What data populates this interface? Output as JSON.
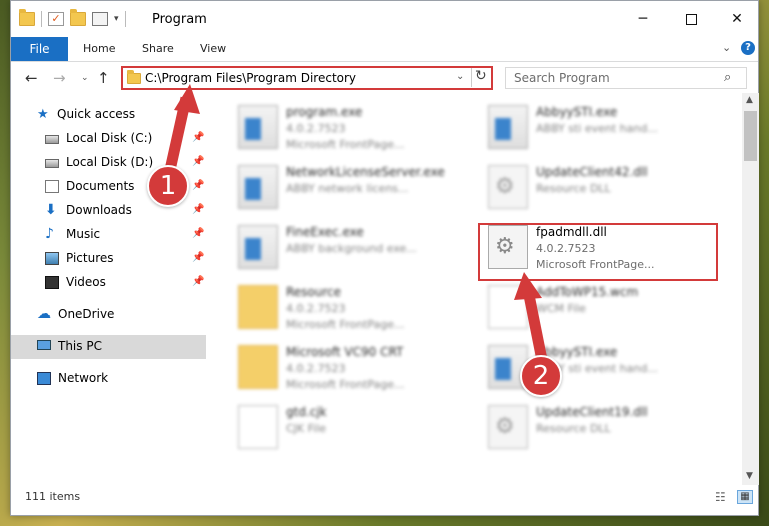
{
  "window": {
    "title": "Program",
    "controls": {
      "minimize": "─",
      "close": "✕"
    }
  },
  "ribbon": {
    "file": "File",
    "home": "Home",
    "share": "Share",
    "view": "View",
    "help": "?"
  },
  "nav": {
    "address": "C:\\Program Files\\Program Directory",
    "search_placeholder": "Search Program"
  },
  "sidebar": {
    "items": [
      {
        "label": "Quick access",
        "icon": "star-icon"
      },
      {
        "label": "Local Disk (C:)",
        "icon": "disk-icon",
        "pinned": true
      },
      {
        "label": "Local Disk (D:)",
        "icon": "disk-icon",
        "pinned": true
      },
      {
        "label": "Documents",
        "icon": "documents-icon",
        "pinned": true
      },
      {
        "label": "Downloads",
        "icon": "downloads-icon",
        "pinned": true
      },
      {
        "label": "Music",
        "icon": "music-icon",
        "pinned": true
      },
      {
        "label": "Pictures",
        "icon": "pictures-icon",
        "pinned": true
      },
      {
        "label": "Videos",
        "icon": "videos-icon",
        "pinned": true
      },
      {
        "label": "OneDrive",
        "icon": "cloud-icon"
      },
      {
        "label": "This PC",
        "icon": "computer-icon",
        "selected": true
      },
      {
        "label": "Network",
        "icon": "network-icon"
      }
    ]
  },
  "files": [
    {
      "name": "program.exe",
      "line2": "4.0.2.7523",
      "line3": "Microsoft FrontPage...",
      "type": "exe"
    },
    {
      "name": "AbbyySTI.exe",
      "line2": "ABBY sti event hand...",
      "line3": "",
      "type": "exe"
    },
    {
      "name": "NetworkLicenseServer.exe",
      "line2": "ABBY network licens...",
      "line3": "",
      "type": "exe"
    },
    {
      "name": "UpdateClient42.dll",
      "line2": "Resource DLL",
      "line3": "",
      "type": "dll"
    },
    {
      "name": "FineExec.exe",
      "line2": "ABBY background exe...",
      "line3": "",
      "type": "exe"
    },
    {
      "name": "fpadmdll.dll",
      "line2": "4.0.2.7523",
      "line3": "Microsoft FrontPage...",
      "type": "dll",
      "highlighted": true
    },
    {
      "name": "Resource",
      "line2": "4.0.2.7523",
      "line3": "Microsoft FrontPage...",
      "type": "folder"
    },
    {
      "name": "AddToWP15.wcm",
      "line2": "WCM File",
      "line3": "",
      "type": "file"
    },
    {
      "name": "Microsoft VC90 CRT",
      "line2": "4.0.2.7523",
      "line3": "Microsoft FrontPage...",
      "type": "folder"
    },
    {
      "name": "AbbyySTI.exe",
      "line2": "ABBY sti event hand...",
      "line3": "",
      "type": "exe"
    },
    {
      "name": "gtd.cjk",
      "line2": "CJK File",
      "line3": "",
      "type": "cjk"
    },
    {
      "name": "UpdateClient19.dll",
      "line2": "Resource DLL",
      "line3": "",
      "type": "dll"
    }
  ],
  "status": {
    "items_count": "111 items"
  },
  "annotations": {
    "step1": "1",
    "step2": "2",
    "color": "#d33a3a"
  }
}
